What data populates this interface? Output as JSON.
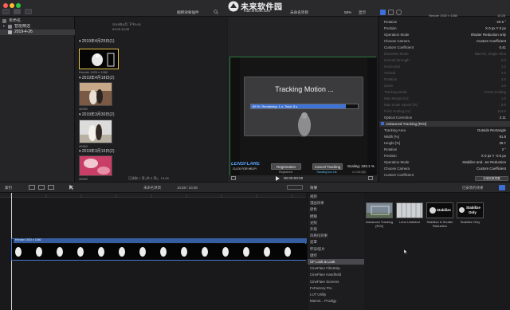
{
  "toolbar": {
    "title": "捆绑效果插件",
    "watermark_main": "未来软件园",
    "watermark_sub": "mac.orsoon.com",
    "viewer_title": "未命名项目",
    "zoom": "58%",
    "view_menu": "显示"
  },
  "library": {
    "items": [
      {
        "label": "未命名"
      },
      {
        "label": "智能精选"
      },
      {
        "label": "2019-4-26"
      }
    ]
  },
  "browser": {
    "top_meta1": "2019年4月 下午9:01",
    "top_meta2": "00:00:15;28",
    "sections": [
      {
        "label": "2019年4月25日",
        "count": "(1)"
      },
      {
        "label": "2019年4月18日",
        "count": "(2)"
      },
      {
        "label": "2019年3月30日",
        "count": "(2)"
      },
      {
        "label": "2019年3月15日",
        "count": "(2)"
      }
    ],
    "clips": [
      {
        "label": "Render 1920 x 1080"
      },
      {
        "label": "46952"
      },
      {
        "label": "49952"
      },
      {
        "label": "28952"
      }
    ],
    "footer": "已选取 1 项 (共 5 项)，10;28"
  },
  "viewer": {
    "dialog_title": "Tracking Motion ...",
    "progress_text": "89 %, Remaining:   1 s, Total:   8 s",
    "progress": 0.89,
    "registration_btn": "Registration",
    "registered": "Registered",
    "cancel_btn": "Cancel Tracking",
    "tracking_box": "Tracking box 1fs",
    "scaling": "Scaling: 103.1 %",
    "scaling_sub": "v 1.0.6 (M)",
    "logo_line1": "LENSFLARE",
    "logo_line2": "CLICK FOR HELP!",
    "timecode": "00:00:00:00"
  },
  "inspector": {
    "header": "Render 1920 x 1080",
    "header_time": "10;28",
    "rows1": [
      {
        "label": "Rotation",
        "value": "-20.6 °",
        "dim": false
      },
      {
        "label": "Position",
        "value": "X 0 px   Y 0 px",
        "dim": false
      },
      {
        "label": "Operation Mode",
        "value": "Shutter Reduction only",
        "dim": false
      },
      {
        "label": "Choose Camera",
        "value": "Custom Coefficient",
        "dim": false
      },
      {
        "label": "Custom Coefficient",
        "value": "0.41",
        "dim": false
      },
      {
        "label": "Distortion Mode",
        "value": "Barrel1, Single Shot",
        "dim": true
      },
      {
        "label": "Overall Strength",
        "value": "0.3",
        "dim": true
      },
      {
        "label": "Horizontal",
        "value": "1.0",
        "dim": true
      },
      {
        "label": "Vertical",
        "value": "1.0",
        "dim": true
      },
      {
        "label": "Rotation",
        "value": "1.0",
        "dim": true
      },
      {
        "label": "Zoom",
        "value": "1.0",
        "dim": true
      },
      {
        "label": "Tracking Mode",
        "value": "Smart Scaling",
        "dim": true
      },
      {
        "label": "Max Margin [%]",
        "value": "1.0",
        "dim": true
      },
      {
        "label": "Max Scale Speed [%]",
        "value": "5.0",
        "dim": true
      },
      {
        "label": "Field Scaling [%]",
        "value": "114.0",
        "dim": true
      },
      {
        "label": "Optical Correction",
        "value": "2.11",
        "dim": false
      }
    ],
    "section2": "Advanced Tracking [ROI]",
    "rows2": [
      {
        "label": "Tracking Area",
        "value": "Outside Rectangle",
        "dim": false
      },
      {
        "label": "Width [%]",
        "value": "91.8",
        "dim": false
      },
      {
        "label": "Height [%]",
        "value": "29.7",
        "dim": false
      },
      {
        "label": "Rotation",
        "value": "0 °",
        "dim": false
      },
      {
        "label": "Position",
        "value": "X 0 px   Y -0.6 px",
        "dim": false
      },
      {
        "label": "Operation Mode",
        "value": "Stabilize and...ter Reduction",
        "dim": false
      },
      {
        "label": "Choose Camera",
        "value": "Custom Coefficient",
        "dim": false
      },
      {
        "label": "Custom Coefficient",
        "value": "",
        "dim": false
      }
    ],
    "save_btn": "存储效果预置"
  },
  "timeline": {
    "index_label": "索引",
    "project_label": "未命名项目",
    "duration": "10;28 / 10;28",
    "clip_label": "Render 1920 x 1080",
    "effects_title": "效果",
    "installed": "已安装的效果"
  },
  "effects": {
    "categories": [
      {
        "label": "视频",
        "selected": false
      },
      {
        "label": "漫画效果",
        "selected": false
      },
      {
        "label": "颜色",
        "selected": false
      },
      {
        "label": "模糊",
        "selected": false
      },
      {
        "label": "光照",
        "selected": false
      },
      {
        "label": "外观",
        "selected": false
      },
      {
        "label": "风格化效果",
        "selected": false
      },
      {
        "label": "遮罩",
        "selected": false
      },
      {
        "label": "怀旧/胶片",
        "selected": false
      },
      {
        "label": "键控",
        "selected": false
      },
      {
        "label": "CF Look & Look",
        "selected": true
      },
      {
        "label": "CineFlare FilmStrip",
        "selected": false
      },
      {
        "label": "CineFlare Handheld",
        "selected": false
      },
      {
        "label": "CineFlare Screens",
        "selected": false
      },
      {
        "label": "FxFactory Pro",
        "selected": false
      },
      {
        "label": "LUT Utility",
        "selected": false
      },
      {
        "label": "Mamm... Prodigy",
        "selected": false
      }
    ],
    "tiles": [
      {
        "label": "Advanced Tracking [ROI]"
      },
      {
        "label": "Lens Undistort"
      },
      {
        "label": "Stabilize & Shutter Reduction"
      },
      {
        "label": "Stabilize Only"
      }
    ],
    "tile3_text": "Stabilize",
    "tile4_text1": "Stabilize",
    "tile4_text2": "Only"
  }
}
